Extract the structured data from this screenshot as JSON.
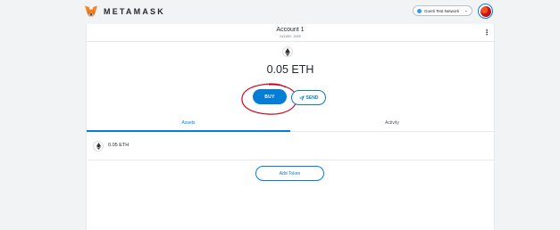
{
  "header": {
    "brand_text": "METAMASK",
    "logo_icon": "metamask-fox-icon",
    "network": {
      "label": "Goerli Test Network",
      "dot_color": "#3099f2",
      "icon": "chevron-down-icon"
    },
    "avatar_icon": "account-identicon"
  },
  "account": {
    "name": "Account 1",
    "address": "0x31B9...2025",
    "menu_icon": "kebab-menu-icon"
  },
  "balance": {
    "token_icon": "eth-icon",
    "amount": "0.05",
    "currency": "ETH",
    "display": "0.05 ETH"
  },
  "actions": {
    "buy_label": "BUY",
    "send_label": "SEND",
    "send_icon": "paper-plane-icon"
  },
  "tabs": [
    {
      "label": "Assets",
      "active": true
    },
    {
      "label": "Activity",
      "active": false
    }
  ],
  "assets": [
    {
      "icon": "eth-icon",
      "amount": "0.05 ETH"
    }
  ],
  "add_token_label": "Add Token",
  "colors": {
    "accent": "#037dd6",
    "annotation": "#d8001d",
    "background": "#f2f3f4"
  }
}
